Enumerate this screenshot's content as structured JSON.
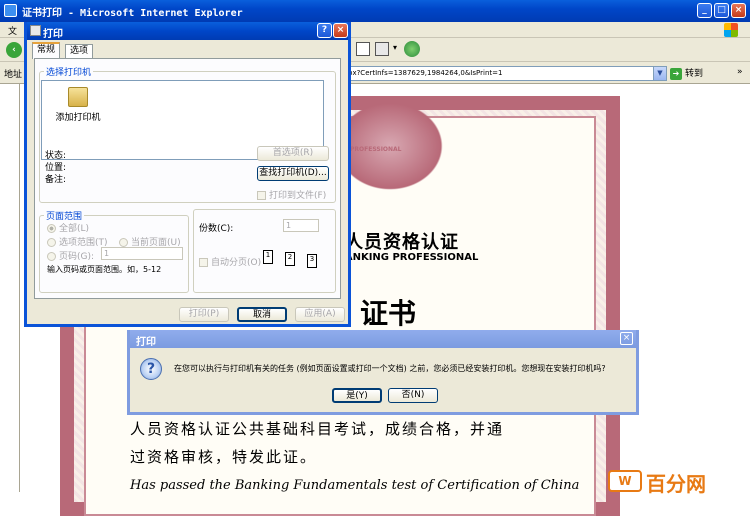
{
  "window": {
    "title": "证书打印 - Microsoft Internet Explorer"
  },
  "menu": {
    "first": "文"
  },
  "addressbar": {
    "left_label": "地址",
    "url": "px?CertInfs=1387629,1984264,0&IsPrint=1",
    "go": "转到"
  },
  "certificate": {
    "band": "PROFESSIONAL",
    "cn_title": "业人员资格认证",
    "en_title": "A BANKING PROFESSIONAL",
    "big": "证书",
    "line1": "人员资格认证公共基础科目考试，成绩合格，并通",
    "line2": "过资格审核，特发此证。",
    "line3": "Has passed the Banking Fundamentals test of Certification of China"
  },
  "print_dialog": {
    "title": "打印",
    "tabs": [
      "常规",
      "选项"
    ],
    "select_printer": "选择打印机",
    "add_printer": "添加打印机",
    "status_label": "状态:",
    "location_label": "位置:",
    "comment_label": "备注:",
    "preferences": "首选项(R)",
    "find_printer": "查找打印机(D)...",
    "print_to_file": "打印到文件(F)",
    "page_range": "页面范围",
    "all": "全部(L)",
    "selection": "选项范围(T)",
    "current_page": "当前页面(U)",
    "pages": "页码(G):",
    "pages_value": "1",
    "hint": "输入页码或页面范围。如，5-12",
    "copies": "份数(C):",
    "copies_value": "1",
    "collate": "自动分页(O)",
    "print": "打印(P)",
    "cancel": "取消",
    "apply": "应用(A)"
  },
  "alert": {
    "title": "打印",
    "message": "在您可以执行与打印机有关的任务 (例如页面设置或打印一个文档) 之前，您必须已经安装打印机。您想现在安装打印机吗?",
    "yes": "是(Y)",
    "no": "否(N)"
  },
  "logo": {
    "mark": "W",
    "text": "百分网"
  }
}
